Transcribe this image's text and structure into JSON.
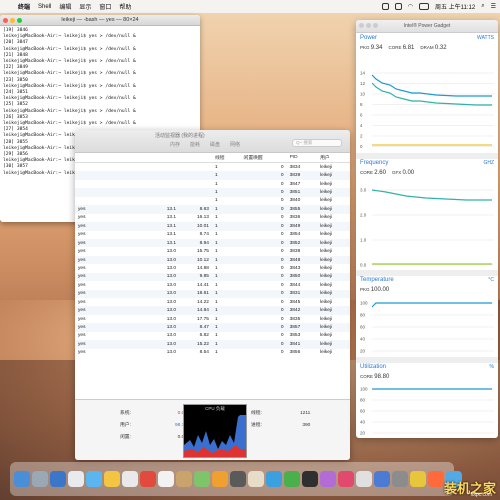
{
  "menubar": {
    "apple": "",
    "app": "终端",
    "items": [
      "Shell",
      "编辑",
      "显示",
      "窗口",
      "帮助"
    ],
    "clock": "周五 上午11:12"
  },
  "terminal": {
    "title": "leikeji — -bash — yes — 80×24",
    "lines": [
      "[19] 3846",
      "leikeji@MacBook-Air:~ leikeji$ yes > /dev/null &",
      "[20] 3847",
      "leikeji@MacBook-Air:~ leikeji$ yes > /dev/null &",
      "[21] 3848",
      "leikeji@MacBook-Air:~ leikeji$ yes > /dev/null &",
      "[22] 3849",
      "leikeji@MacBook-Air:~ leikeji$ yes > /dev/null &",
      "[23] 3850",
      "leikeji@MacBook-Air:~ leikeji$ yes > /dev/null &",
      "[24] 3851",
      "leikeji@MacBook-Air:~ leikeji$ yes > /dev/null &",
      "[25] 3852",
      "leikeji@MacBook-Air:~ leikeji$ yes > /dev/null &",
      "[26] 3853",
      "leikeji@MacBook-Air:~ leikeji$ yes > /dev/null &",
      "[27] 3854",
      "leikeji@MacBook-Air:~ leikeji$ yes > /dev/null &",
      "[28] 3855",
      "leikeji@MacBook-Air:~ leikeji$ yes > /dev/null &",
      "[29] 3856",
      "leikeji@MacBook-Air:~ leikeji$ yes > /dev/null &",
      "[30] 3857",
      "leikeji@MacBook-Air:~ leikeji$ ▊"
    ]
  },
  "activity": {
    "title": "活动监视器 (我的进程)",
    "tabs": [
      "内存",
      "能耗",
      "磁盘",
      "网络"
    ],
    "search_placeholder": "Q~ 搜索",
    "columns": [
      "",
      "",
      "",
      "线程",
      "闲置唤醒",
      "PID",
      "用户"
    ],
    "rows": [
      [
        "",
        "",
        "",
        "1",
        "0",
        "3834",
        "leikeji"
      ],
      [
        "",
        "",
        "",
        "1",
        "0",
        "3839",
        "leikeji"
      ],
      [
        "",
        "",
        "",
        "1",
        "0",
        "3847",
        "leikeji"
      ],
      [
        "",
        "",
        "",
        "1",
        "0",
        "3851",
        "leikeji"
      ],
      [
        "",
        "",
        "",
        "1",
        "0",
        "3840",
        "leikeji"
      ],
      [
        "yes",
        "13.1",
        "8.63",
        "1",
        "0",
        "3855",
        "leikeji"
      ],
      [
        "yes",
        "13.1",
        "16.13",
        "1",
        "0",
        "3836",
        "leikeji"
      ],
      [
        "yes",
        "13.1",
        "10.01",
        "1",
        "0",
        "3849",
        "leikeji"
      ],
      [
        "yes",
        "13.1",
        "8.74",
        "1",
        "0",
        "3854",
        "leikeji"
      ],
      [
        "yes",
        "13.1",
        "8.94",
        "1",
        "0",
        "3852",
        "leikeji"
      ],
      [
        "yes",
        "13.0",
        "15.75",
        "1",
        "0",
        "3838",
        "leikeji"
      ],
      [
        "yes",
        "13.0",
        "10.12",
        "1",
        "0",
        "3848",
        "leikeji"
      ],
      [
        "yes",
        "13.0",
        "14.88",
        "1",
        "0",
        "3843",
        "leikeji"
      ],
      [
        "yes",
        "13.0",
        "9.85",
        "1",
        "0",
        "3850",
        "leikeji"
      ],
      [
        "yes",
        "13.0",
        "14.41",
        "1",
        "0",
        "3844",
        "leikeji"
      ],
      [
        "yes",
        "13.0",
        "18.61",
        "1",
        "0",
        "3831",
        "leikeji"
      ],
      [
        "yes",
        "13.0",
        "14.22",
        "1",
        "0",
        "3845",
        "leikeji"
      ],
      [
        "yes",
        "13.0",
        "14.84",
        "1",
        "0",
        "3842",
        "leikeji"
      ],
      [
        "yes",
        "13.0",
        "17.75",
        "1",
        "0",
        "3835",
        "leikeji"
      ],
      [
        "yes",
        "13.0",
        "8.47",
        "1",
        "0",
        "3857",
        "leikeji"
      ],
      [
        "yes",
        "13.0",
        "6.82",
        "1",
        "0",
        "3853",
        "leikeji"
      ],
      [
        "yes",
        "13.0",
        "15.22",
        "1",
        "0",
        "3841",
        "leikeji"
      ],
      [
        "yes",
        "13.0",
        "8.54",
        "1",
        "0",
        "3856",
        "leikeji"
      ]
    ],
    "footer": {
      "labels": [
        "系统:",
        "用户:",
        "闲置:"
      ],
      "values": [
        "0.00%",
        "98.70%",
        "0.00%"
      ],
      "cpu_label": "CPU 负载",
      "right_labels": [
        "线程:",
        "进程:"
      ],
      "right_values": [
        "1211",
        "390"
      ]
    }
  },
  "power": {
    "title": "Intel® Power Gadget",
    "power": {
      "heading": "Power",
      "unit": "WATTS",
      "pkg": "9.34",
      "core": "6.81",
      "dram": "0.32",
      "ticks": [
        "14",
        "12",
        "10",
        "8",
        "6",
        "4",
        "2",
        "0"
      ]
    },
    "frequency": {
      "heading": "Frequency",
      "unit": "GHZ",
      "core": "2.60",
      "gfx": "0.00",
      "ticks": [
        "3.0",
        "2.0",
        "1.0",
        "0.0"
      ]
    },
    "temperature": {
      "heading": "Temperature",
      "unit": "°C",
      "pkg": "100.00",
      "ticks": [
        "100",
        "80",
        "60",
        "40",
        "20"
      ]
    },
    "utilization": {
      "heading": "Utilization",
      "unit": "%",
      "core": "98.80",
      "ticks": [
        "100",
        "80",
        "60",
        "40",
        "20"
      ]
    }
  },
  "dock": {
    "watermark": "装机之家",
    "watermark_sub": "lotpc.com"
  },
  "colors": {
    "accent": "#2a7ad4",
    "pkg": "#1a9ad6",
    "core": "#2fb3a8",
    "dram": "#f2c230"
  }
}
